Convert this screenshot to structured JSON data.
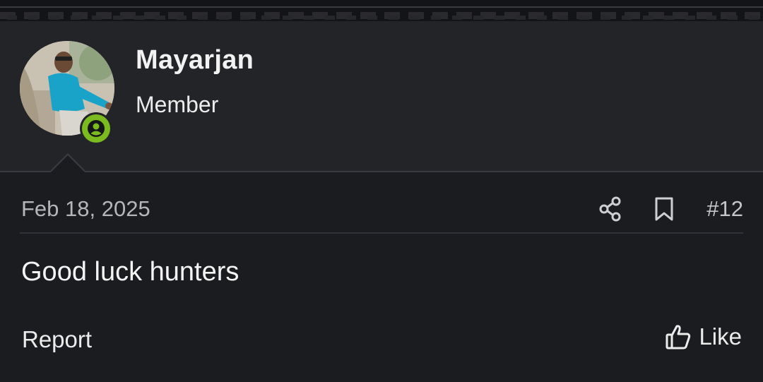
{
  "user": {
    "name": "Mayarjan",
    "role": "Member",
    "online_color": "#7cbb1f"
  },
  "post": {
    "date": "Feb 18, 2025",
    "number": "#12",
    "body": "Good luck hunters"
  },
  "actions": {
    "share_icon": "share-icon",
    "bookmark_icon": "bookmark-icon",
    "report_label": "Report",
    "like_label": "Like",
    "like_icon": "thumbs-up-icon"
  }
}
